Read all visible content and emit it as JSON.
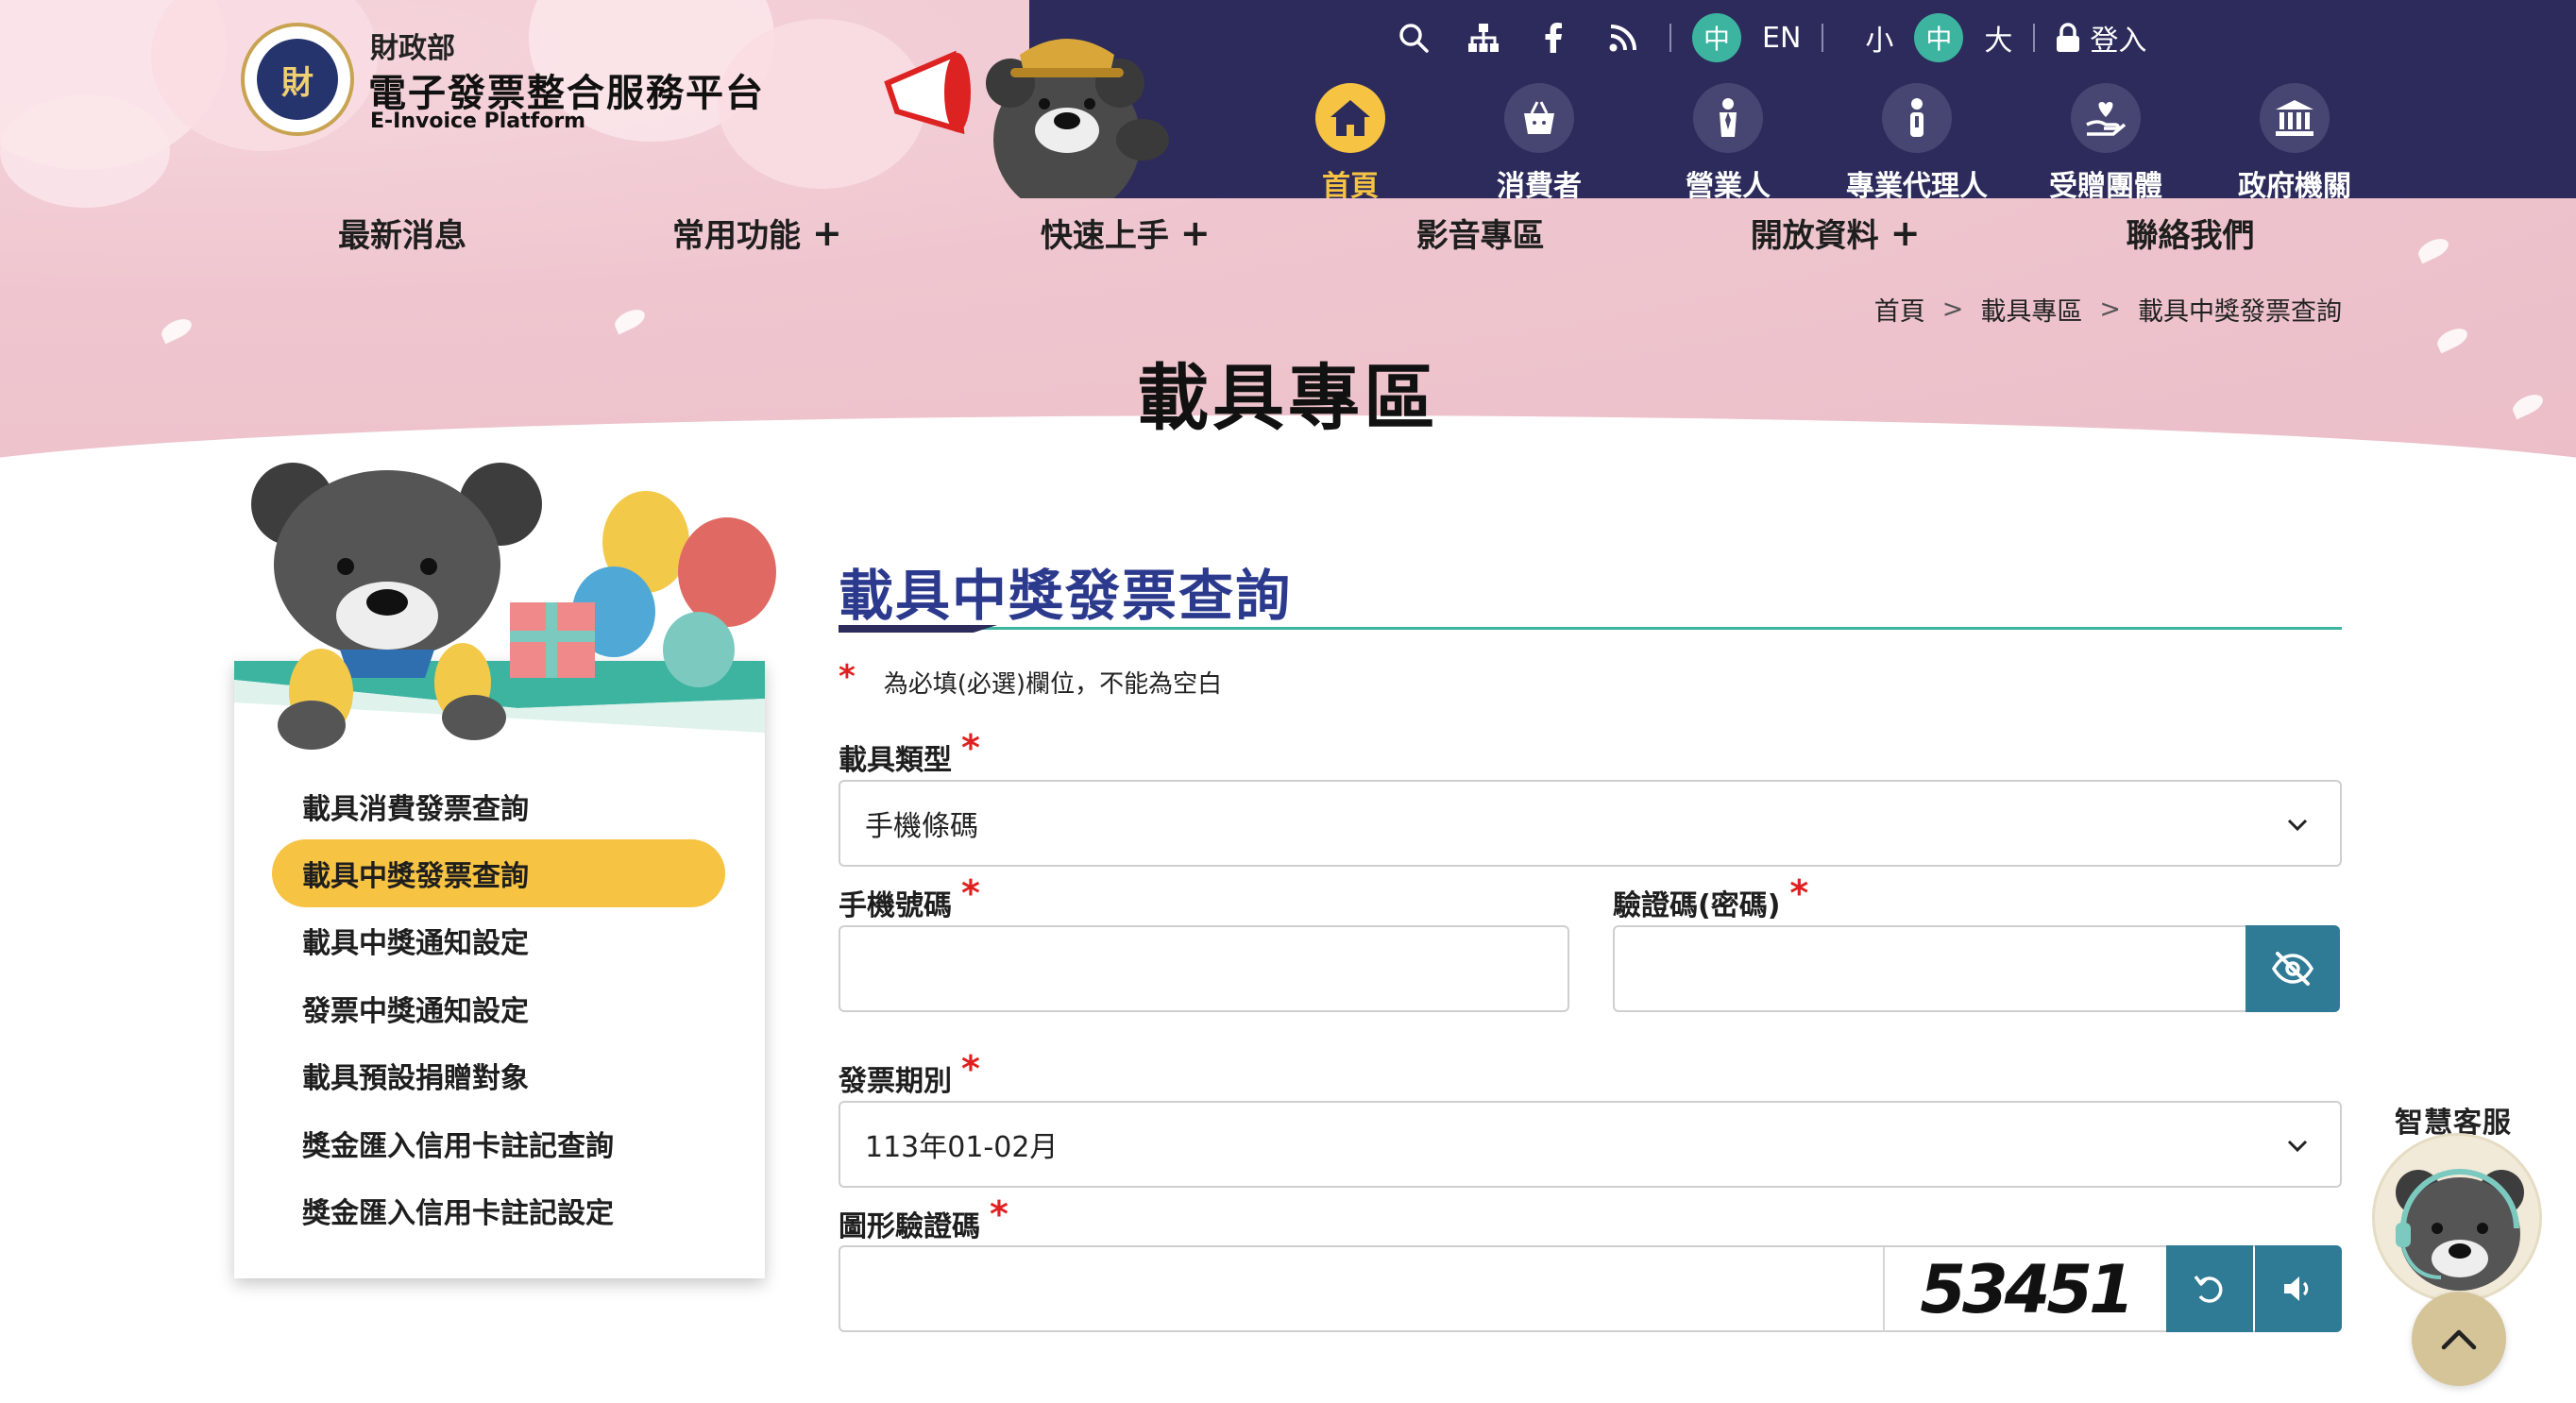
{
  "brand": {
    "org": "財政部",
    "name": "電子發票整合服務平台",
    "name_en": "E-Invoice Platform",
    "logo_text": "財"
  },
  "utility": {
    "icons": [
      "search-icon",
      "sitemap-icon",
      "facebook-icon",
      "rss-icon"
    ],
    "lang_zh": "中",
    "lang_en": "EN",
    "size_small": "小",
    "size_medium": "中",
    "size_large": "大",
    "login": "登入"
  },
  "roles": [
    {
      "label": "首頁",
      "icon": "home-icon",
      "active": true
    },
    {
      "label": "消費者",
      "icon": "shopping-bag-icon",
      "active": false
    },
    {
      "label": "營業人",
      "icon": "businessman-icon",
      "active": false
    },
    {
      "label": "專業代理人",
      "icon": "agent-icon",
      "active": false
    },
    {
      "label": "受贈團體",
      "icon": "donation-hand-icon",
      "active": false
    },
    {
      "label": "政府機關",
      "icon": "government-building-icon",
      "active": false
    }
  ],
  "main_nav": [
    {
      "label": "最新消息",
      "plus": ""
    },
    {
      "label": "常用功能",
      "plus": "+"
    },
    {
      "label": "快速上手",
      "plus": "+"
    },
    {
      "label": "影音專區",
      "plus": ""
    },
    {
      "label": "開放資料",
      "plus": "+"
    },
    {
      "label": "聯絡我們",
      "plus": ""
    }
  ],
  "breadcrumb": [
    "首頁",
    "載具專區",
    "載具中獎發票查詢"
  ],
  "breadcrumb_sep": ">",
  "page_title": "載具專區",
  "sidebar": {
    "items": [
      {
        "label": "載具消費發票查詢",
        "active": false
      },
      {
        "label": "載具中獎發票查詢",
        "active": true
      },
      {
        "label": "載具中獎通知設定",
        "active": false
      },
      {
        "label": "發票中獎通知設定",
        "active": false
      },
      {
        "label": "載具預設捐贈對象",
        "active": false
      },
      {
        "label": "獎金匯入信用卡註記查詢",
        "active": false
      },
      {
        "label": "獎金匯入信用卡註記設定",
        "active": false
      }
    ]
  },
  "form": {
    "heading": "載具中獎發票查詢",
    "required_mark": "*",
    "required_note": "為必填(必選)欄位，不能為空白",
    "carrier_type_label": "載具類型",
    "carrier_type_value": "手機條碼",
    "phone_barcode_label": "手機號碼",
    "phone_barcode_value": "",
    "password_label": "驗證碼(密碼)",
    "password_value": "",
    "period_label": "發票期別",
    "period_value": "113年01-02月",
    "captcha_label": "圖形驗證碼",
    "captcha_value": "",
    "captcha_image_text": "53451"
  },
  "floating": {
    "customer_service": "智慧客服"
  },
  "colors": {
    "navy": "#2c2b5b",
    "accent_yellow": "#f6c343",
    "teal": "#3cb4a0",
    "button_blue": "#2f7a95",
    "heading_blue": "#2c3a8e",
    "pink": "#efc6cf"
  }
}
